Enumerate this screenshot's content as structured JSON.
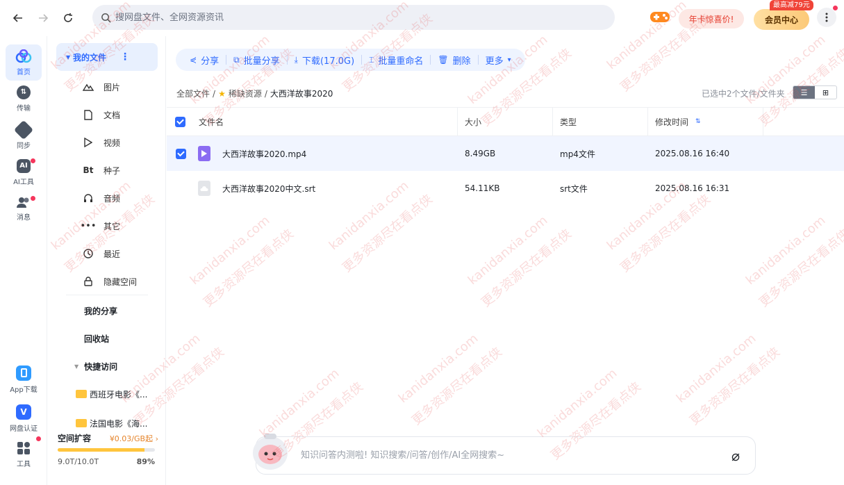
{
  "topbar": {
    "search_placeholder": "搜网盘文件、全网资源资讯",
    "promo_label": "年卡惊喜价!",
    "vip_label": "会员中心",
    "vip_tag": "最高减79元"
  },
  "rail": {
    "items": [
      {
        "label": "首页",
        "icon": "home-icon"
      },
      {
        "label": "传输",
        "icon": "transfer-icon"
      },
      {
        "label": "同步",
        "icon": "sync-icon"
      },
      {
        "label": "AI工具",
        "icon": "ai-tool-icon"
      },
      {
        "label": "消息",
        "icon": "message-icon"
      },
      {
        "label": "App下载",
        "icon": "app-download-icon"
      },
      {
        "label": "网盘认证",
        "icon": "verify-icon"
      },
      {
        "label": "工具",
        "icon": "tools-icon"
      }
    ]
  },
  "nav": {
    "my_files": "我的文件",
    "categories": [
      "图片",
      "文档",
      "视频",
      "种子",
      "音频",
      "其它",
      "最近",
      "隐藏空间"
    ],
    "my_share": "我的分享",
    "recycle": "回收站",
    "quick_access": "快捷访问",
    "quick_items": [
      "西班牙电影《...",
      "法国电影《海..."
    ]
  },
  "storage": {
    "title": "空间扩容",
    "price": "¥0.03/GB起",
    "used": "9.0T/10.0T",
    "percent_label": "89%",
    "percent": 0.89
  },
  "toolbar": {
    "share": "分享",
    "batch_share": "批量分享",
    "download": "下载(17.0G)",
    "batch_rename": "批量重命名",
    "delete": "删除",
    "more": "更多"
  },
  "breadcrumb": {
    "root": "全部文件",
    "sep": "/",
    "level1": "稀缺资源",
    "current": "大西洋故事2020"
  },
  "selection_info": "已选中2个文件/文件夹",
  "table": {
    "headers": {
      "name": "文件名",
      "size": "大小",
      "type": "类型",
      "modified": "修改时间"
    },
    "rows": [
      {
        "name": "大西洋故事2020.mp4",
        "size": "8.49GB",
        "type": "mp4文件",
        "modified": "2025.08.16 16:40",
        "selected": true
      },
      {
        "name": "大西洋故事2020中文.srt",
        "size": "54.11KB",
        "type": "srt文件",
        "modified": "2025.08.16 16:31",
        "selected": false
      }
    ]
  },
  "ai_bar": {
    "placeholder": "知识问答内测啦! 知识搜索/问答/创作/AI全网搜索~"
  },
  "watermark": {
    "line1": "kanidanxia.com",
    "line2": "更多资源尽在看点侠"
  },
  "colors": {
    "accent": "#2f6bff",
    "selected_row": "#f1f5ff",
    "storage_fill": "#ffc53d",
    "badge": "#f5365c"
  }
}
